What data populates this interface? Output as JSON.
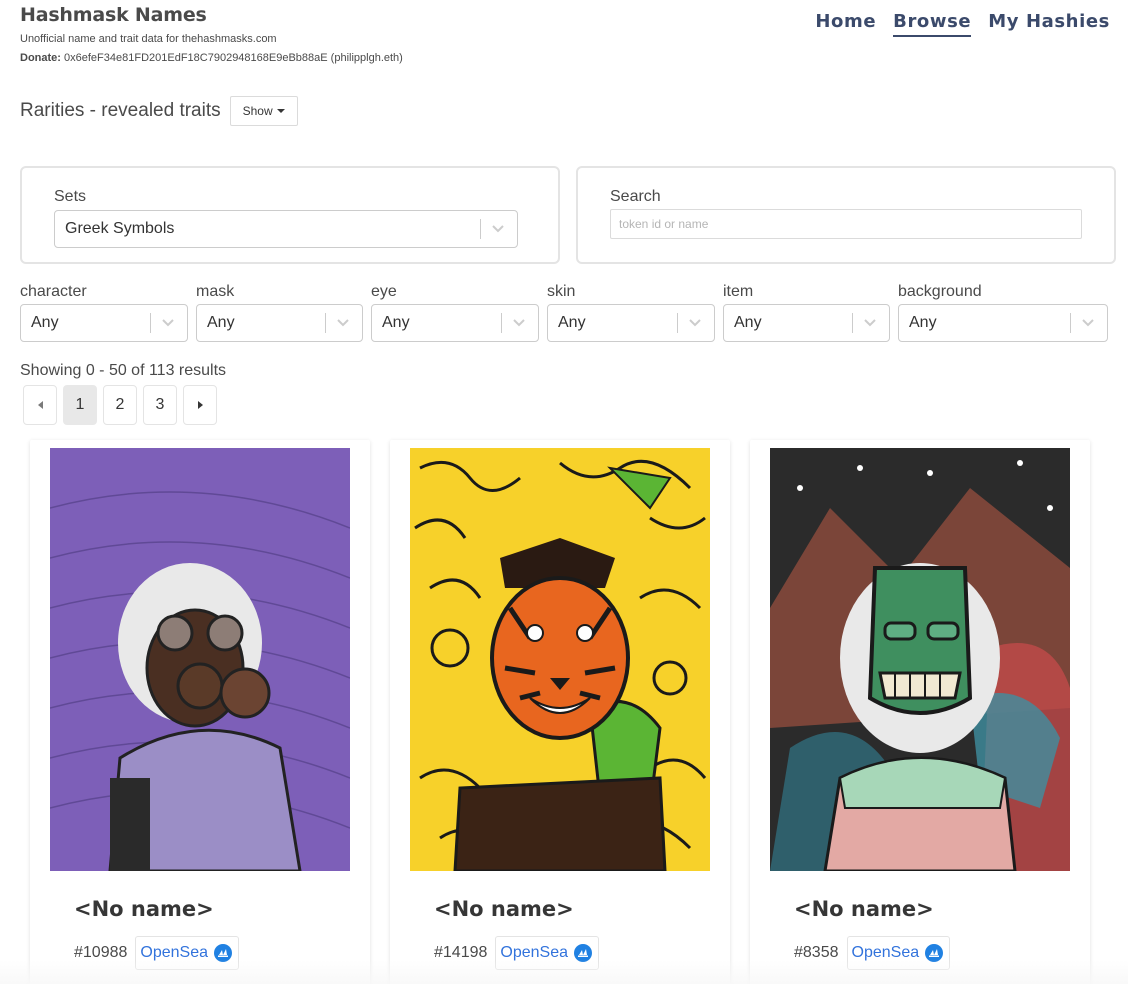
{
  "site": {
    "title": "Hashmask Names",
    "subtitle": "Unofficial name and trait data for thehashmasks.com",
    "donate_label": "Donate:",
    "donate_value": "0x6efeF34e81FD201EdF18C7902948168E9eBb88aE (philipplgh.eth)"
  },
  "nav": {
    "items": [
      {
        "label": "Home",
        "active": false
      },
      {
        "label": "Browse",
        "active": true
      },
      {
        "label": "My Hashies",
        "active": false
      }
    ]
  },
  "rarities": {
    "title": "Rarities - revealed traits",
    "show_label": "Show"
  },
  "sets": {
    "label": "Sets",
    "selected": "Greek Symbols"
  },
  "search": {
    "label": "Search",
    "placeholder": "token id or name",
    "value": ""
  },
  "filters": [
    {
      "label": "character",
      "selected": "Any"
    },
    {
      "label": "mask",
      "selected": "Any"
    },
    {
      "label": "eye",
      "selected": "Any"
    },
    {
      "label": "skin",
      "selected": "Any"
    },
    {
      "label": "item",
      "selected": "Any"
    },
    {
      "label": "background",
      "selected": "Any"
    }
  ],
  "results": {
    "text": "Showing 0 - 50 of 113 results"
  },
  "pagination": {
    "pages": [
      "1",
      "2",
      "3"
    ],
    "current": "1"
  },
  "cards": [
    {
      "name": "<No name>",
      "token": "#10988",
      "link_label": "OpenSea",
      "bg_color": "#7d5fb8",
      "hair_color": "#e9e9e9",
      "mask_color": "#5a3a28",
      "mask_type": "gas-mask"
    },
    {
      "name": "<No name>",
      "token": "#14198",
      "link_label": "OpenSea",
      "bg_color": "#f7d12a",
      "hair_color": "#2a1a12",
      "mask_color": "#e8661f",
      "mask_type": "tiger-mask"
    },
    {
      "name": "<No name>",
      "token": "#8358",
      "link_label": "OpenSea",
      "bg_color": "#2b2b2b",
      "hair_color": "#e9e9e9",
      "mask_color": "#3f8f5f",
      "mask_type": "tiki-mask"
    }
  ]
}
